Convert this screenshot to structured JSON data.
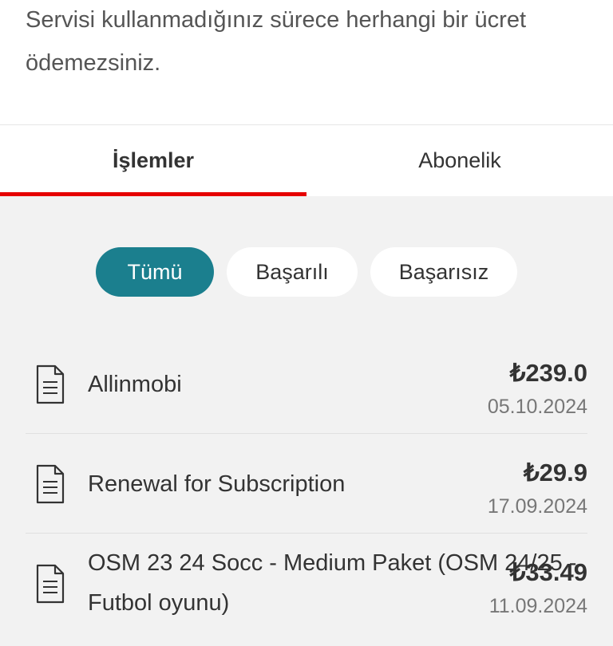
{
  "info": {
    "text": "Servisi kullanmadığınız sürece herhangi bir ücret ödemezsiniz."
  },
  "tabs": [
    {
      "label": "İşlemler",
      "active": true
    },
    {
      "label": "Abonelik",
      "active": false
    }
  ],
  "filters": [
    {
      "label": "Tümü",
      "active": true
    },
    {
      "label": "Başarılı",
      "active": false
    },
    {
      "label": "Başarısız",
      "active": false
    }
  ],
  "transactions": [
    {
      "title": "Allinmobi",
      "amount": "₺239.0",
      "date": "05.10.2024",
      "icon": "document-icon"
    },
    {
      "title": "Renewal for Subscription",
      "amount": "₺29.9",
      "date": "17.09.2024",
      "icon": "document-icon"
    },
    {
      "title": "OSM 23 24 Socc - Medium Paket (OSM 24/25 - Futbol oyunu)",
      "amount": "₺33.49",
      "date": "11.09.2024",
      "icon": "document-icon"
    }
  ],
  "colors": {
    "accent": "#1b7f8e",
    "tab_underline": "#e60000"
  }
}
